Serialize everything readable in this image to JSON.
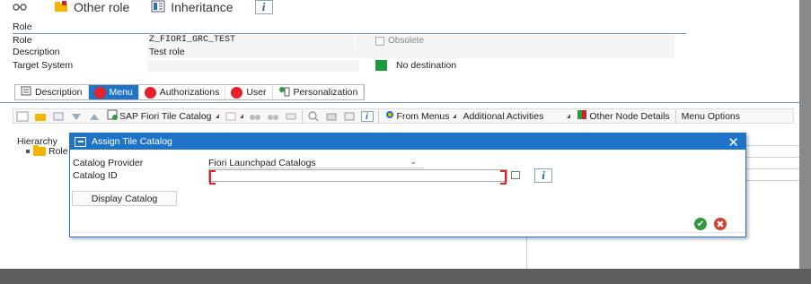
{
  "toolbar": {
    "other_role": "Other role",
    "inheritance": "Inheritance",
    "info_glyph": "i",
    "icons": [
      "glasses-icon",
      "other-role-icon",
      "inheritance-icon",
      "info-icon"
    ]
  },
  "role": {
    "section_title": "Role",
    "role_label": "Role",
    "role_value": "Z_FIORI_GRC_TEST",
    "obsolete_label": "Obsolete",
    "description_label": "Description",
    "description_value": "Test role",
    "target_system_label": "Target System",
    "no_destination": "No destination"
  },
  "tabs": [
    {
      "label": "Description",
      "active": false
    },
    {
      "label": "Menu",
      "active": true
    },
    {
      "label": "Authorizations",
      "active": false
    },
    {
      "label": "User",
      "active": false
    },
    {
      "label": "Personalization",
      "active": false
    }
  ],
  "menu_toolbar": {
    "sap_fiori_tile_catalog": "SAP Fiori Tile Catalog",
    "from_menus": "From Menus",
    "additional_activities": "Additional Activities",
    "other_node_details": "Other Node Details",
    "menu_options": "Menu Options",
    "info_glyph": "i"
  },
  "hierarchy": {
    "label": "Hierarchy",
    "root": "Role"
  },
  "dialog": {
    "title": "Assign Tile Catalog",
    "close_glyph": "✕",
    "catalog_provider_label": "Catalog Provider",
    "catalog_provider_value": "Fiori Launchpad Catalogs",
    "catalog_id_label": "Catalog ID",
    "catalog_id_value": "",
    "display_catalog_button": "Display Catalog",
    "info_glyph": "i",
    "ok_glyph": "✔",
    "cancel_glyph": "✖"
  },
  "colors": {
    "sap_blue": "#1f74c8",
    "status_red": "#e4202a",
    "status_green": "#1a9a3c",
    "folder_yellow": "#f4b400"
  }
}
